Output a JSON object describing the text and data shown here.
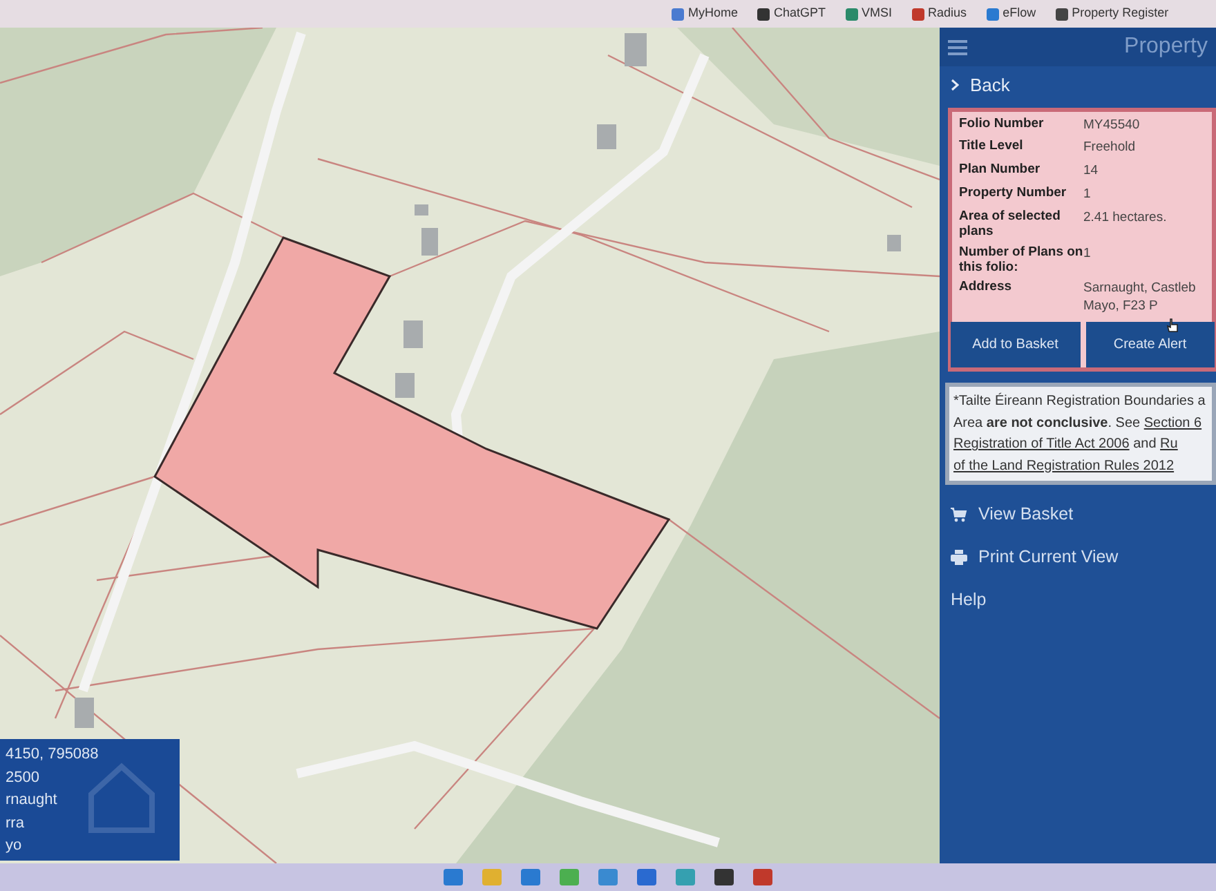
{
  "bookmarks": [
    {
      "label": "MyHome"
    },
    {
      "label": "ChatGPT"
    },
    {
      "label": "VMSI"
    },
    {
      "label": "Radius"
    },
    {
      "label": "eFlow"
    },
    {
      "label": "Property Register"
    }
  ],
  "sidebar": {
    "title": "Property",
    "back": "Back",
    "details": [
      {
        "label": "Folio Number",
        "value": "MY45540"
      },
      {
        "label": "Title Level",
        "value": "Freehold"
      },
      {
        "label": "Plan Number",
        "value": "14"
      },
      {
        "label": "Property Number",
        "value": "1"
      },
      {
        "label": "Area of selected plans",
        "value": "2.41 hectares."
      },
      {
        "label": "Number of Plans on this folio:",
        "value": "1"
      },
      {
        "label": "Address",
        "value": "Sarnaught, Castleb\nMayo, F23 P"
      }
    ],
    "buttons": [
      "Add to Basket",
      "Create Alert"
    ],
    "notice": [
      [
        {
          "kind": "plain",
          "text": "*Tailte Éireann Registration Boundaries a"
        }
      ],
      [
        {
          "kind": "plain",
          "text": "Area "
        },
        {
          "kind": "bold",
          "text": "are not conclusive"
        },
        {
          "kind": "plain",
          "text": ". See "
        },
        {
          "kind": "link",
          "text": "Section 6"
        }
      ],
      [
        {
          "kind": "link",
          "text": "Registration of Title Act 2006"
        },
        {
          "kind": "plain",
          "text": " and "
        },
        {
          "kind": "link",
          "text": "Ru"
        }
      ],
      [
        {
          "kind": "link",
          "text": "of the Land Registration Rules 2012"
        }
      ]
    ],
    "menu": [
      {
        "kind": "basket",
        "label": "View Basket"
      },
      {
        "kind": "print",
        "label": "Print Current View"
      },
      {
        "kind": "plain",
        "label": "Help"
      }
    ]
  },
  "location_panel": {
    "lines": [
      "4150, 795088",
      "2500",
      "rnaught",
      "rra",
      "yo"
    ]
  }
}
